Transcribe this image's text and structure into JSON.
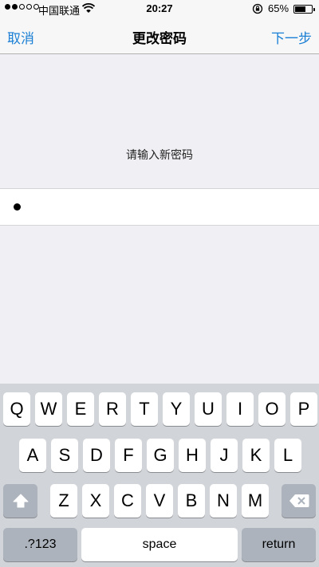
{
  "status_bar": {
    "carrier": "中国联通",
    "time": "20:27",
    "battery_percent": "65%",
    "battery_level": 0.65,
    "signal_strength": 2,
    "signal_max": 5
  },
  "nav": {
    "cancel_label": "取消",
    "title": "更改密码",
    "next_label": "下一步"
  },
  "content": {
    "prompt": "请输入新密码",
    "password_dots": 1
  },
  "keyboard": {
    "row1": [
      "Q",
      "W",
      "E",
      "R",
      "T",
      "Y",
      "U",
      "I",
      "O",
      "P"
    ],
    "row2": [
      "A",
      "S",
      "D",
      "F",
      "G",
      "H",
      "J",
      "K",
      "L"
    ],
    "row3": [
      "Z",
      "X",
      "C",
      "V",
      "B",
      "N",
      "M"
    ],
    "numbers_label": ".?123",
    "space_label": "space",
    "return_label": "return",
    "shift_icon": "shift-arrow-icon",
    "delete_icon": "backspace-icon"
  },
  "colors": {
    "accent": "#1a7fd4",
    "background": "#efeff4",
    "keyboard_bg": "#d1d4d9",
    "dark_key": "#acb3bc"
  }
}
